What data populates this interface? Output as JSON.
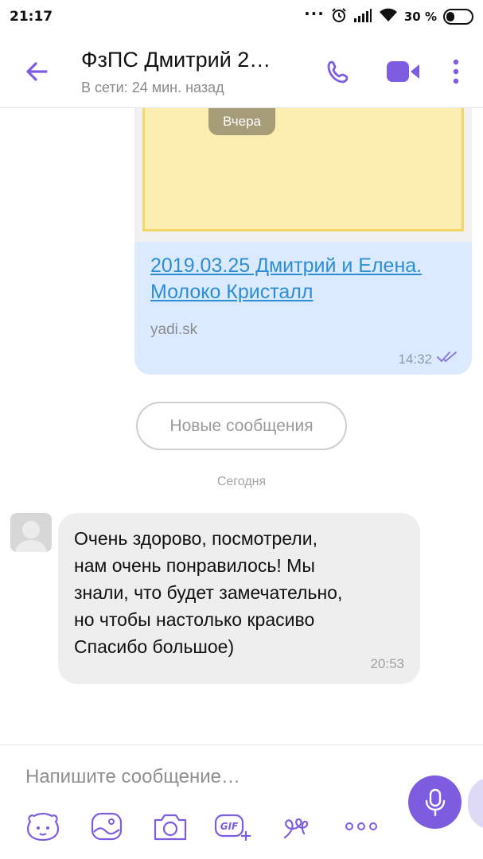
{
  "status_bar": {
    "time": "21:17",
    "battery_percent": "30 %",
    "icons": [
      "more-dots-icon",
      "alarm-icon",
      "signal-icon",
      "wifi-icon",
      "battery-icon"
    ]
  },
  "header": {
    "title": "ФзПС Дмитрий 2…",
    "subtitle": "В сети: 24 мин. назад",
    "accent_color": "#7d5ce0",
    "icons": [
      "back-arrow-icon",
      "phone-icon",
      "video-call-icon",
      "more-vertical-icon"
    ]
  },
  "messages": {
    "yesterday_label": "Вчера",
    "link_card": {
      "title": "2019.03.25 Дмитрий и Елена. Молоко Кристалл",
      "domain": "yadi.sk",
      "time": "14:32",
      "status_icon": "double-check-icon"
    },
    "new_messages_button": "Новые сообщения",
    "today_label": "Сегодня",
    "incoming": {
      "text": "Очень здорово, посмотрели,\nнам очень понравилось! Мы\nзнали, что будет замечательно,\nно чтобы настолько красиво\n Спасибо большое)",
      "time": "20:53"
    }
  },
  "composer": {
    "placeholder": "Напишите сообщение…",
    "send_icon": "microphone-icon",
    "toolbar_icons": [
      "sticker-icon",
      "gallery-icon",
      "camera-icon",
      "gif-icon",
      "doodle-icon",
      "more-horizontal-icon"
    ]
  }
}
